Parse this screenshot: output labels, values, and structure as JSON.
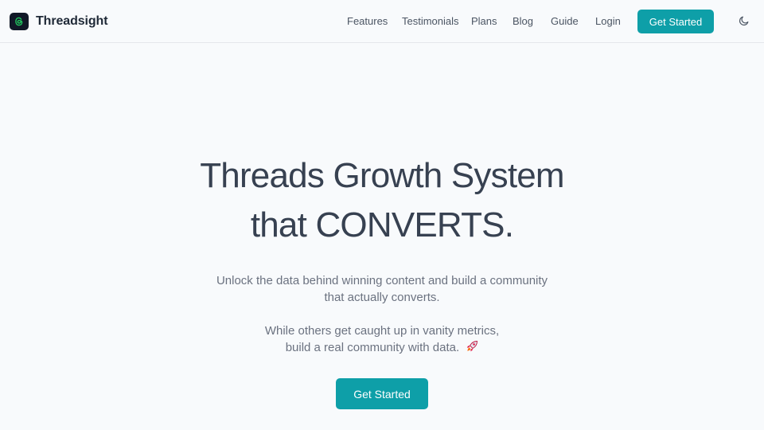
{
  "brand": {
    "name": "Threadsight",
    "logo_icon": "threads-logo-icon"
  },
  "nav": {
    "links": [
      "Features",
      "Testimonials",
      "Plans",
      "Blog",
      "Guide",
      "Login"
    ],
    "cta_label": "Get Started",
    "theme_icon": "moon-icon"
  },
  "hero": {
    "title_line1": "Threads Growth System",
    "title_line2": "that CONVERTS.",
    "subtitle_line1": "Unlock the data behind winning content and build a community",
    "subtitle_line2": "that actually converts.",
    "tagline_line1": "While others get caught up in vanity metrics,",
    "tagline_line2": "build a real community with data.",
    "tagline_icon": "rocket-icon",
    "cta_label": "Get Started"
  },
  "colors": {
    "accent": "#0e9fa8",
    "background": "#f8fafc",
    "heading": "#374151",
    "body_text": "#6b7280"
  }
}
